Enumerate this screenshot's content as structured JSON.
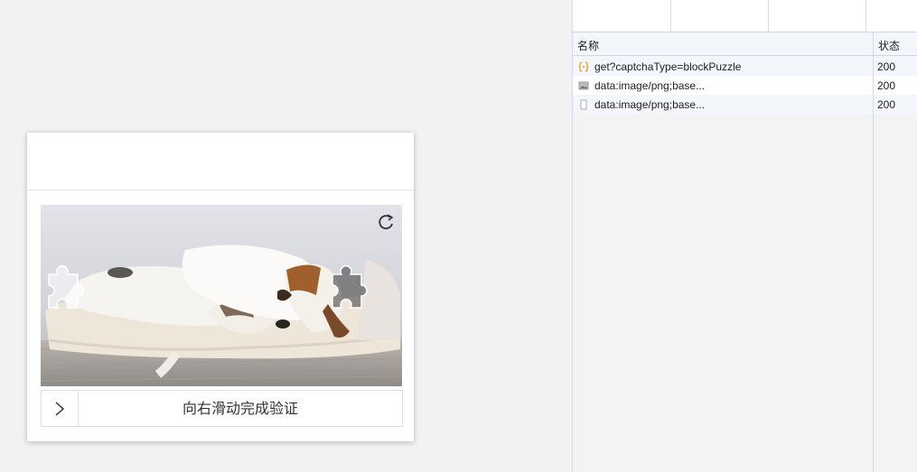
{
  "captcha": {
    "slider_text": "向右滑动完成验证",
    "refresh_icon": "refresh-icon",
    "slider_icon": "chevron-right-icon",
    "puzzle_piece": "puzzle-piece",
    "puzzle_slot": "puzzle-slot"
  },
  "network": {
    "columns": {
      "name": "名称",
      "status": "状态"
    },
    "rows": [
      {
        "icon": "xhr-icon",
        "name": "get?captchaType=blockPuzzle",
        "status": "200"
      },
      {
        "icon": "image-icon",
        "name": "data:image/png;base...",
        "status": "200"
      },
      {
        "icon": "document-icon",
        "name": "data:image/png;base...",
        "status": "200"
      }
    ]
  }
}
